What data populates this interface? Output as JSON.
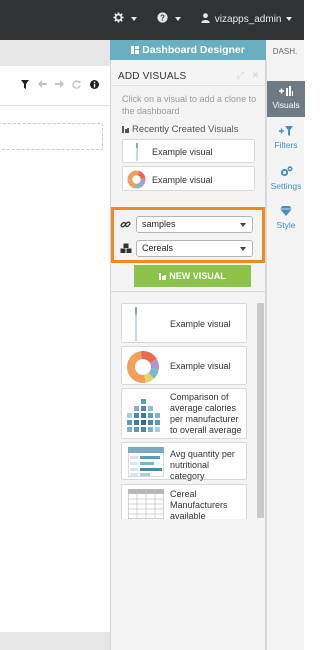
{
  "topbar": {
    "settings_icon": "gear-icon",
    "help_icon": "question-icon",
    "user_icon": "user-icon",
    "username": "vizapps_admin"
  },
  "left_toolbar": {
    "icons": [
      "filter-icon",
      "undo-icon",
      "redo-icon",
      "refresh-icon",
      "info-icon"
    ]
  },
  "designer": {
    "tab_label": "Dashboard Designer"
  },
  "add_visuals": {
    "title": "ADD VISUALS",
    "hint": "Click on a visual to add a clone to the dashboard",
    "recent_title": "Recently Created Visuals",
    "recent": [
      {
        "label": "Example visual",
        "thumb": "line-chart"
      },
      {
        "label": "Example visual",
        "thumb": "donut-chart"
      }
    ],
    "connection_select": "samples",
    "dataset_select": "Cereals",
    "new_visual_label": "NEW VISUAL",
    "visuals": [
      {
        "label": "Example visual",
        "thumb": "line-chart"
      },
      {
        "label": "Example visual",
        "thumb": "donut-chart"
      },
      {
        "label": "Comparison of average calories per manufacturer to overall average",
        "thumb": "heatmap"
      },
      {
        "label": "Avg quantity per nutritional category",
        "thumb": "table-chart"
      },
      {
        "label": "Cereal Manufacturers available",
        "thumb": "grid-table"
      }
    ]
  },
  "side_tabs": {
    "header": "DASH.",
    "items": [
      {
        "label": "Visuals",
        "icon": "plus-bar-icon",
        "active": true
      },
      {
        "label": "Filters",
        "icon": "plus-filter-icon",
        "active": false
      },
      {
        "label": "Settings",
        "icon": "gears-icon",
        "active": false
      },
      {
        "label": "Style",
        "icon": "diamond-icon",
        "active": false
      }
    ]
  },
  "colors": {
    "topbar": "#2f3335",
    "designer_tab": "#6aaec1",
    "highlight": "#f18a21",
    "new_visual": "#8bc34a",
    "side_link": "#4a8fb8"
  }
}
